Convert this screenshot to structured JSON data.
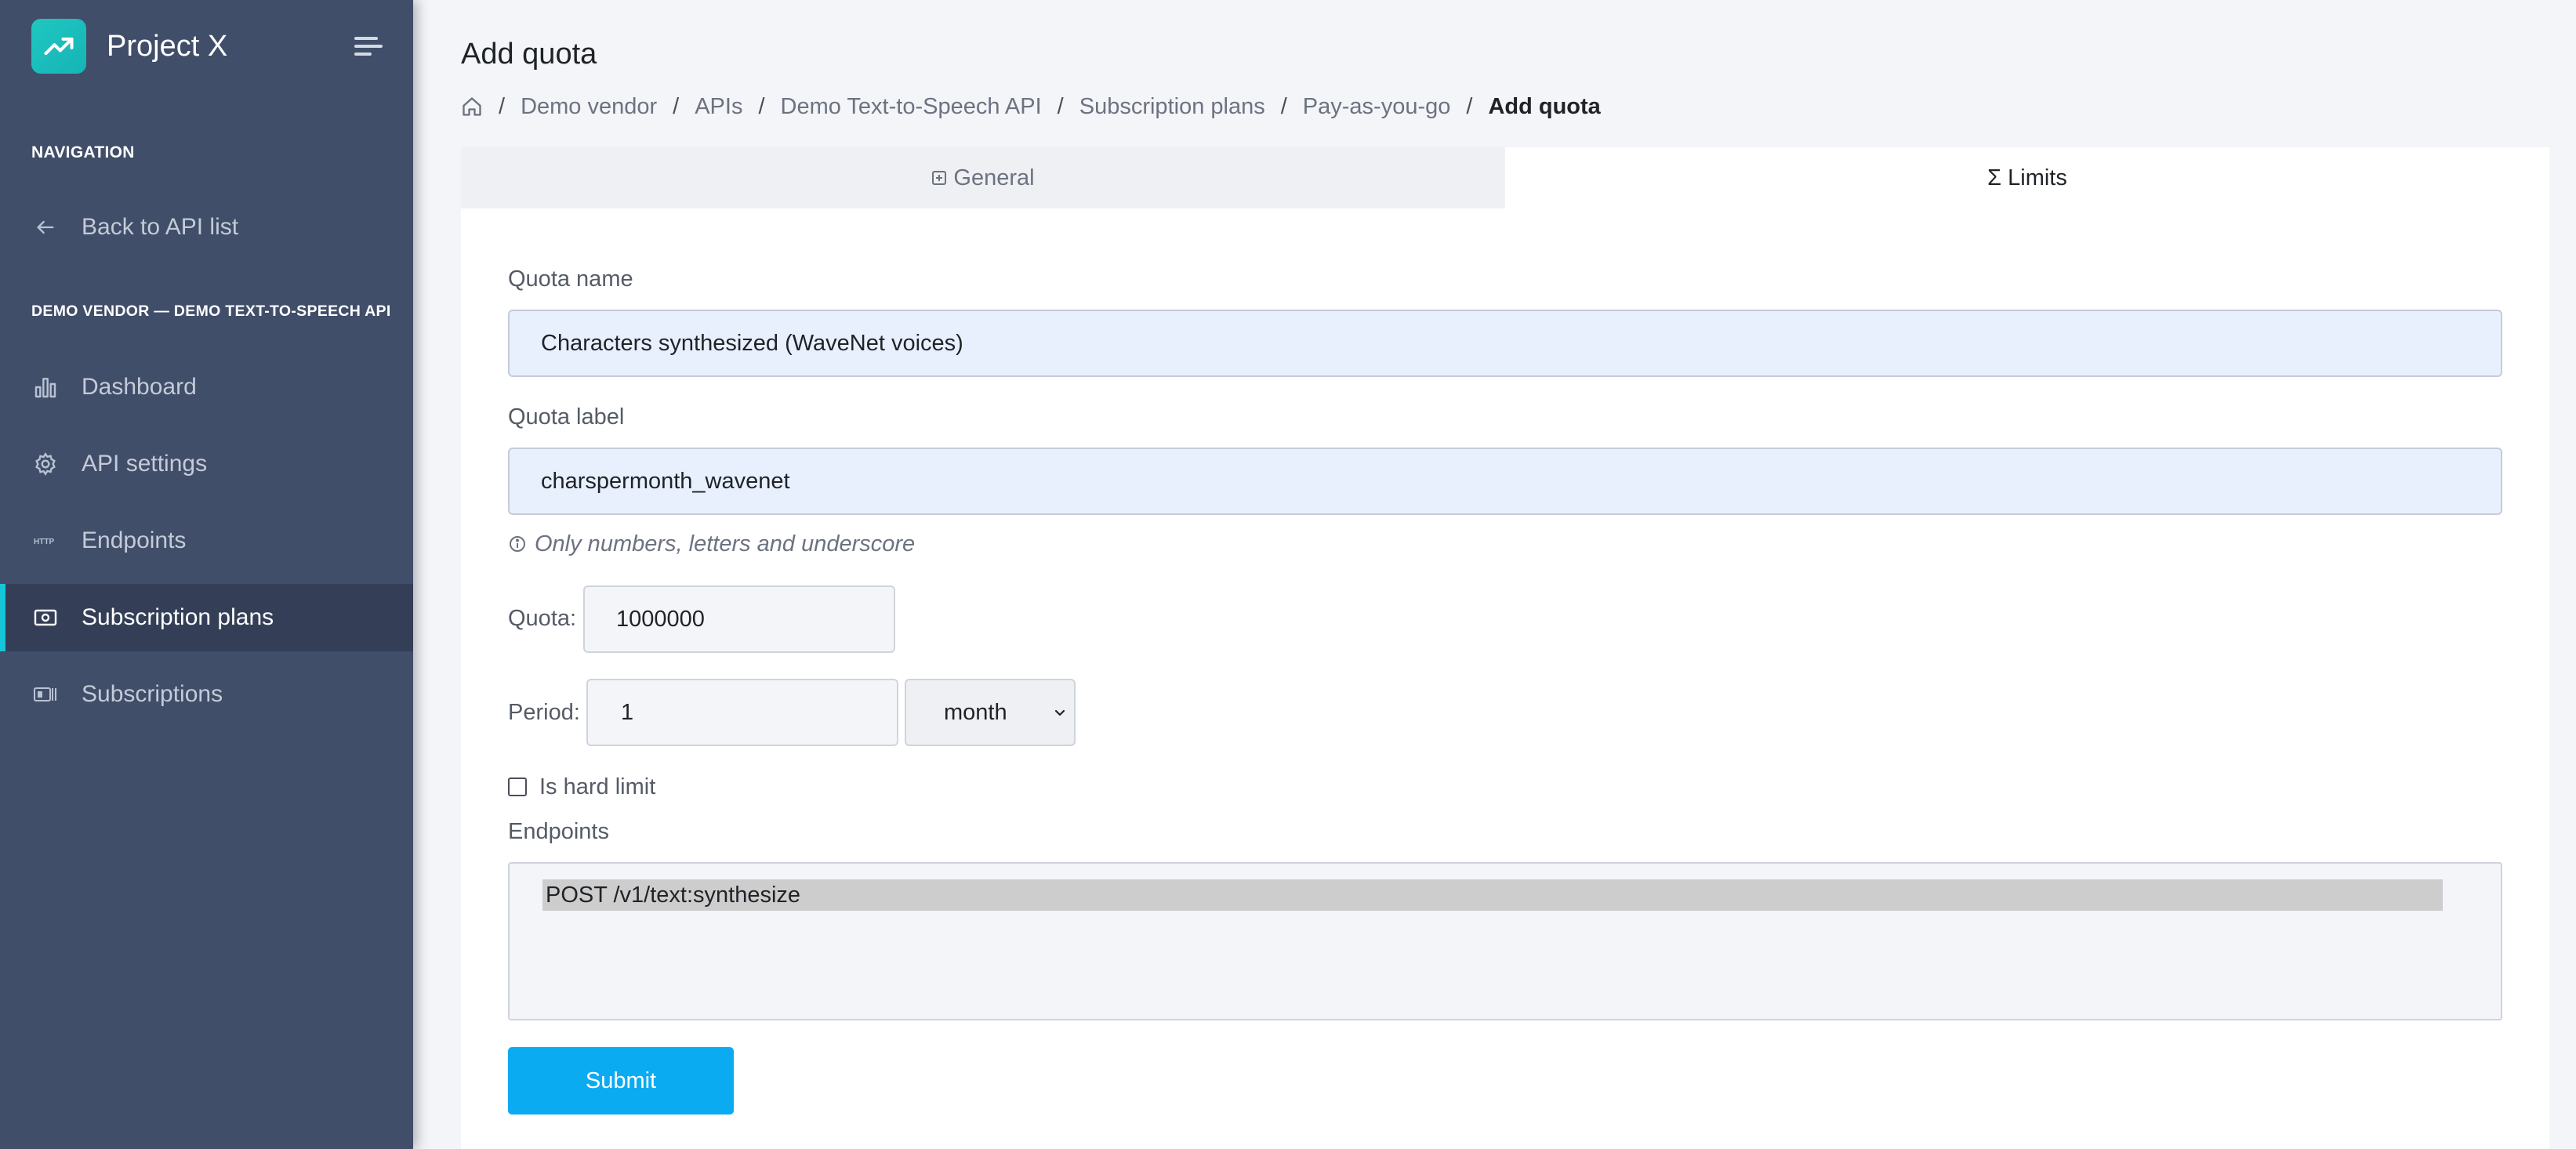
{
  "app": {
    "name": "Project X"
  },
  "sidebar": {
    "navigation_title": "NAVIGATION",
    "back_item": {
      "label": "Back to API list",
      "icon": "arrow-left-icon"
    },
    "context_title": "DEMO VENDOR — DEMO TEXT-TO-SPEECH API",
    "items": [
      {
        "label": "Dashboard",
        "icon": "bar-chart-icon"
      },
      {
        "label": "API settings",
        "icon": "gear-icon"
      },
      {
        "label": "Endpoints",
        "icon": "http-icon"
      },
      {
        "label": "Subscription plans",
        "icon": "dollar-bill-icon",
        "active": true
      },
      {
        "label": "Subscriptions",
        "icon": "id-card-icon"
      }
    ]
  },
  "page": {
    "title": "Add quota",
    "breadcrumb": [
      "Demo vendor",
      "APIs",
      "Demo Text-to-Speech API",
      "Subscription plans",
      "Pay-as-you-go",
      "Add quota"
    ]
  },
  "tabs": [
    {
      "label": "General",
      "icon": "square-plus-icon",
      "active": false
    },
    {
      "label": "Σ Limits",
      "active": true
    }
  ],
  "form": {
    "quota_name": {
      "label": "Quota name",
      "value": "Characters synthesized (WaveNet voices)"
    },
    "quota_label": {
      "label": "Quota label",
      "value": "charspermonth_wavenet"
    },
    "hint": "Only numbers, letters and underscore",
    "quota": {
      "label": "Quota:",
      "value": "1000000"
    },
    "period": {
      "label": "Period:",
      "value": "1",
      "unit": "month"
    },
    "hard_limit": {
      "label": "Is hard limit",
      "checked": false
    },
    "endpoints": {
      "label": "Endpoints",
      "options": [
        "POST /v1/text:synthesize"
      ]
    },
    "submit_label": "Submit"
  },
  "colors": {
    "sidebar_bg": "#414e69",
    "sidebar_active_bg": "#343f57",
    "accent": "#16c6d8",
    "primary_button": "#0aabf0",
    "logo": "#1fc8c0"
  }
}
